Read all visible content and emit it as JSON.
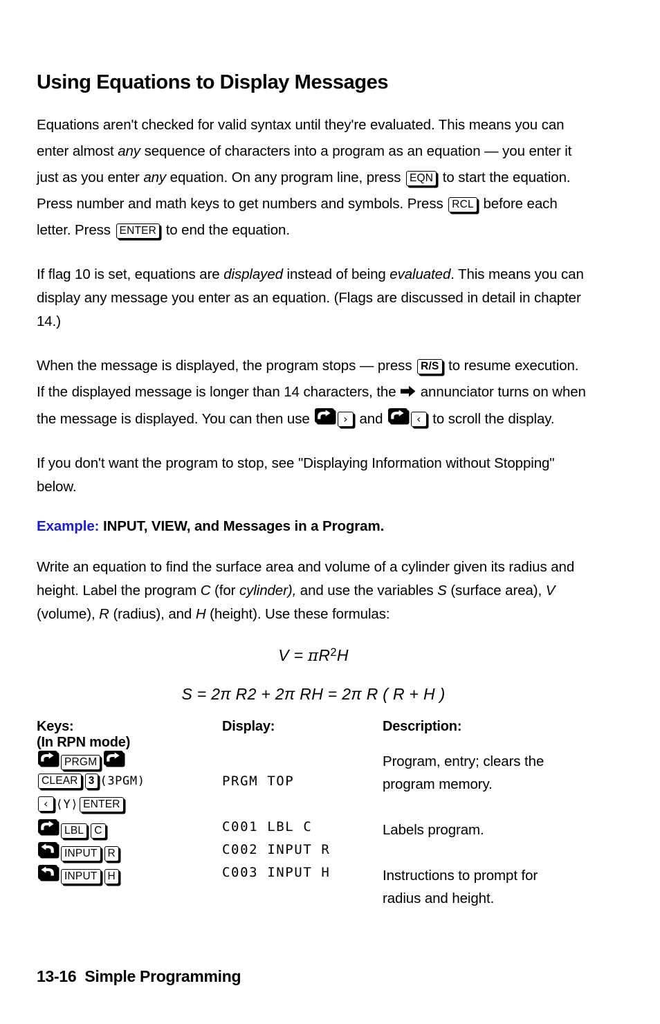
{
  "page": {
    "title": "Using Equations to Display Messages",
    "footer_page_number": "13-16",
    "footer_section": "Simple Programming"
  },
  "paragraphs": {
    "p1": {
      "s1": "Equations aren't checked for valid syntax until they're evaluated. This means you can enter almost ",
      "i1": "any",
      "s2": " sequence of characters into a program as an equation — you enter it just as you enter ",
      "i2": "any",
      "s3": " equation. On any program line, press ",
      "key1": "EQN",
      "s4": " to start the equation. Press number and math keys to get numbers and symbols. Press ",
      "key2": "RCL",
      "s5": " before each letter. Press ",
      "key3": "ENTER",
      "s6": " to end the equation."
    },
    "p2": {
      "s1": "If flag 10 is set, equations are ",
      "i1": "displayed",
      "s2": " instead of being ",
      "i2": "evaluated",
      "s3": ". This means you can display any message you enter as an equation. (Flags are discussed in detail in chapter 14.)"
    },
    "p3": {
      "s1": "When the message is displayed, the program stops — press ",
      "key1": "R/S",
      "s2": " to resume execution. If the displayed message is longer than 14 characters, the ",
      "annunciator": "right-arrow-annunciator",
      "s3": " annunciator turns on when the message is displayed. You can then use ",
      "shift1": "right-shift",
      "key2": "›",
      "s4": " and ",
      "shift2": "right-shift",
      "key3": "‹",
      "s5": " to scroll the display."
    },
    "p4": {
      "s1": "If you don't want the program to stop, see \"Displaying Information without Stopping\" below."
    },
    "example": {
      "label": "Example:",
      "text": "INPUT, VIEW, and Messages in a Program."
    },
    "p5": {
      "s1": "Write an equation to find the surface area and volume of a cylinder given its radius and height. Label the program ",
      "i1": "C",
      "s2": " (for ",
      "i2": "cylinder),",
      "s3": " and use the variables ",
      "i3": "S",
      "s4": " (surface area), ",
      "i4": "V",
      "s5": " (volume), ",
      "i5": "R",
      "s6": " (radius), and ",
      "i6": "H",
      "s7": " (height). Use these formulas:"
    }
  },
  "formulas": {
    "volume": "V = πR2H",
    "volume_parts": {
      "lhs": "V",
      "eq": "= ",
      "pi": "π",
      "r": "R",
      "exp": "2",
      "h": "H"
    },
    "surface": "S = 2π R2 + 2π RH = 2π R ( R + H )"
  },
  "table": {
    "headers": {
      "keys": "Keys:",
      "keys_note": "(In RPN mode)",
      "display": "Display:",
      "description": "Description:"
    },
    "rows": [
      {
        "keys": [
          {
            "type": "shift",
            "name": "right-shift"
          },
          {
            "type": "cap",
            "label": "PRGM"
          },
          {
            "type": "shift",
            "name": "right-shift"
          }
        ],
        "display": "",
        "description": "Program, entry; clears the"
      },
      {
        "keys": [
          {
            "type": "cap",
            "label": "CLEAR"
          },
          {
            "type": "cap-bold",
            "label": "3"
          },
          {
            "type": "lcd",
            "label": "(3PGM)"
          }
        ],
        "display": "PRGM TOP",
        "description": "program memory."
      },
      {
        "keys": [
          {
            "type": "cap-arrow",
            "label": "‹"
          },
          {
            "type": "lcd",
            "label": "⟨Y⟩"
          },
          {
            "type": "cap",
            "label": "ENTER"
          }
        ],
        "display": "",
        "description": ""
      },
      {
        "keys": [
          {
            "type": "shift",
            "name": "right-shift"
          },
          {
            "type": "cap",
            "label": "LBL"
          },
          {
            "type": "cap",
            "label": "C"
          }
        ],
        "display": "C001 LBL C",
        "description": "Labels program."
      },
      {
        "keys": [
          {
            "type": "shift",
            "name": "left-shift"
          },
          {
            "type": "cap",
            "label": "INPUT"
          },
          {
            "type": "cap",
            "label": "R"
          }
        ],
        "display": "C002 INPUT R",
        "description": ""
      },
      {
        "keys": [
          {
            "type": "shift",
            "name": "left-shift"
          },
          {
            "type": "cap",
            "label": "INPUT"
          },
          {
            "type": "cap",
            "label": "H"
          }
        ],
        "display": "C003 INPUT H",
        "description": "Instructions to prompt for"
      },
      {
        "keys": [],
        "display": "",
        "description": "radius and height."
      }
    ]
  },
  "colors": {
    "text": "#000000",
    "example_label": "#1b1bdf",
    "background": "#ffffff"
  }
}
